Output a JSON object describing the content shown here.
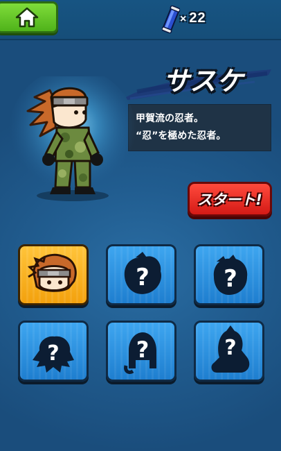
{
  "header": {
    "home_label": "home",
    "scroll_count": "22",
    "multiply_sign": "×"
  },
  "character": {
    "name": "サスケ",
    "description_lines": [
      "甲賀流の忍者。",
      "“忍”を極めた忍者。"
    ]
  },
  "start_button": {
    "label": "スタート!"
  },
  "slots": [
    {
      "state": "selected",
      "icon": "sasuke-face-icon"
    },
    {
      "state": "locked",
      "icon": "unknown-silhouette-icon"
    },
    {
      "state": "locked",
      "icon": "unknown-silhouette-icon"
    },
    {
      "state": "locked",
      "icon": "unknown-silhouette-icon"
    },
    {
      "state": "locked",
      "icon": "unknown-silhouette-icon"
    },
    {
      "state": "locked",
      "icon": "unknown-silhouette-icon"
    }
  ],
  "colors": {
    "home_green": "#5fc225",
    "start_red": "#e32a22",
    "selected_gold": "#f8b022",
    "locked_blue": "#2b8fe0"
  }
}
